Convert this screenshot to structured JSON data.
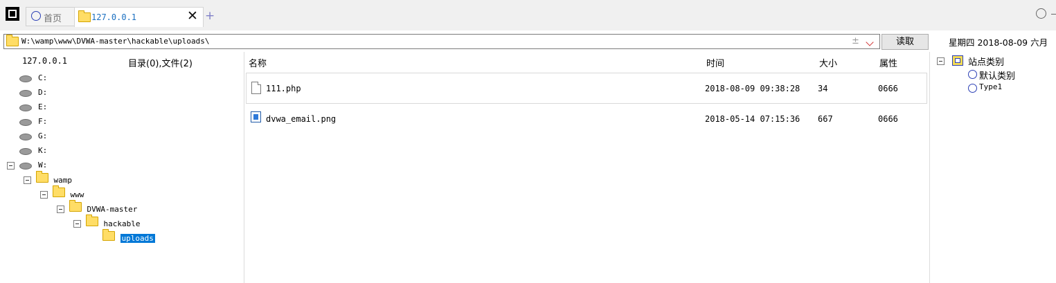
{
  "tabs": [
    {
      "label": "首页"
    },
    {
      "label": "127.0.0.1"
    }
  ],
  "address": {
    "path": "W:\\wamp\\www\\DVWA-master\\hackable\\uploads\\",
    "plusminus": "±",
    "read_label": "读取"
  },
  "date_info": "星期四 2018-08-09 六月",
  "left_panel": {
    "host": "127.0.0.1",
    "summary": "目录(0),文件(2)",
    "drives": [
      "C:",
      "D:",
      "E:",
      "F:",
      "G:",
      "K:",
      "W:"
    ],
    "tree": [
      "wamp",
      "www",
      "DVWA-master",
      "hackable",
      "uploads"
    ]
  },
  "file_list": {
    "columns": {
      "name": "名称",
      "time": "时间",
      "size": "大小",
      "attr": "属性"
    },
    "rows": [
      {
        "name": "111.php",
        "time": "2018-08-09 09:38:28",
        "size": "34",
        "attr": "0666",
        "icon": "document-icon"
      },
      {
        "name": "dvwa_email.png",
        "time": "2018-05-14 07:15:36",
        "size": "667",
        "attr": "0666",
        "icon": "image-file-icon"
      }
    ]
  },
  "site_panel": {
    "category_title": "站点类别",
    "items": [
      "默认类别",
      "Type1"
    ]
  },
  "colors": {
    "accent": "#0078d7",
    "tab_text": "#1a6fc0",
    "icon_blue": "#2b3fb5",
    "folder": "#ffdd66"
  }
}
